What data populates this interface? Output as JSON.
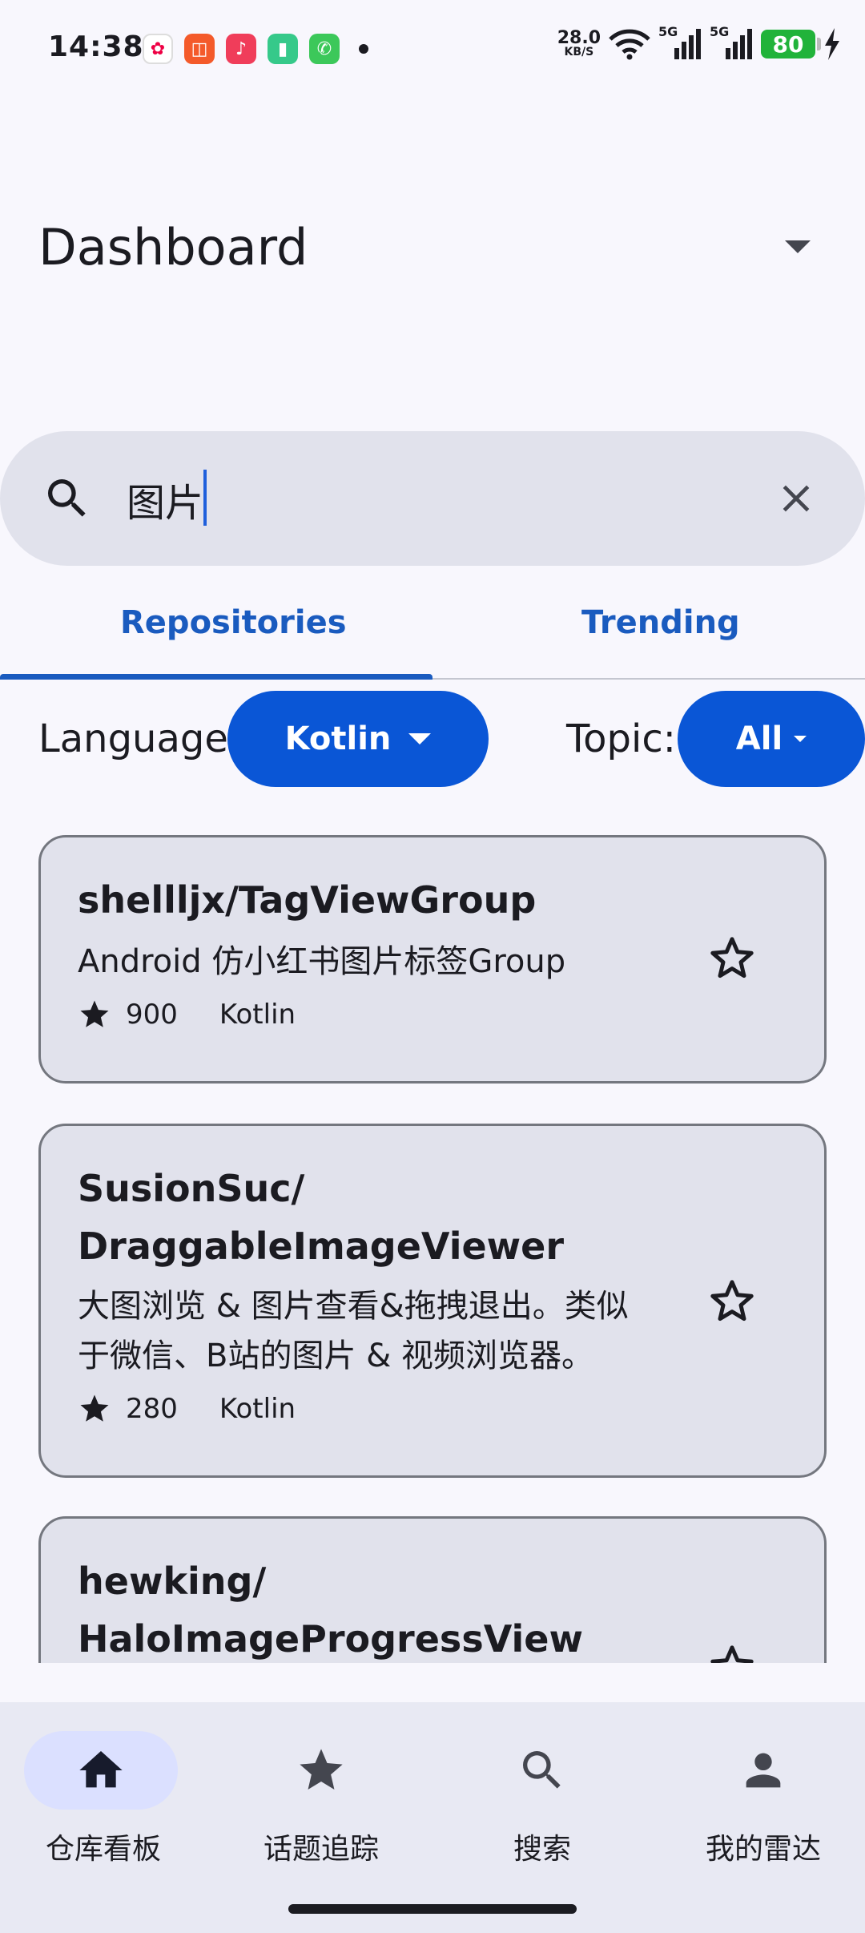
{
  "status_bar": {
    "time": "14:38",
    "net_speed_value": "28.0",
    "net_speed_unit": "KB/S",
    "signal_1": "5G",
    "signal_2": "5G",
    "battery": "80"
  },
  "top_bar": {
    "title": "Dashboard"
  },
  "search": {
    "value": "图片"
  },
  "tabs": [
    {
      "label": "Repositories",
      "selected": true
    },
    {
      "label": "Trending",
      "selected": false
    }
  ],
  "filters": {
    "language_label": "Language:",
    "language_value": "Kotlin",
    "topic_label": "Topic:",
    "topic_value": "All"
  },
  "repos": [
    {
      "title": "shellljx/TagViewGroup",
      "description": "Android 仿小红书图片标签Group",
      "stars": "900",
      "language": "Kotlin"
    },
    {
      "title_line1": "SusionSuc/",
      "title_line2": "DraggableImageViewer",
      "desc_line1": "大图浏览 & 图片查看&拖拽退出。类似",
      "desc_line2": "于微信、B站的图片 & 视频浏览器。",
      "stars": "280",
      "language": "Kotlin"
    },
    {
      "title_line1": "hewking/",
      "title_line2": "HaloImageProgressView"
    }
  ],
  "bottom_nav": [
    {
      "label": "仓库看板",
      "icon": "home-icon",
      "selected": true
    },
    {
      "label": "话题追踪",
      "icon": "star-icon",
      "selected": false
    },
    {
      "label": "搜索",
      "icon": "search-icon",
      "selected": false
    },
    {
      "label": "我的雷达",
      "icon": "person-icon",
      "selected": false
    }
  ],
  "colors": {
    "accent": "#0a56d6",
    "tab_text": "#1a5bbf",
    "card_bg": "#e1e2ec",
    "nav_pill": "#dbe0ff"
  }
}
